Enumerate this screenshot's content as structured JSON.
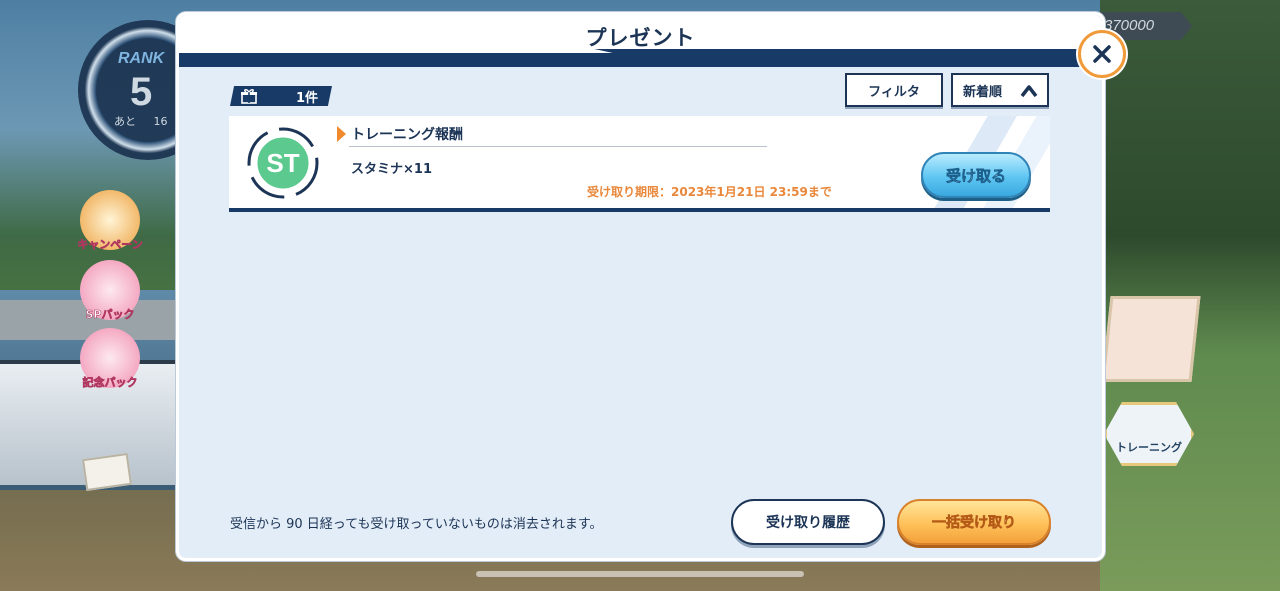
{
  "hud": {
    "rank_label": "RANK",
    "rank_value": "5",
    "rank_next_prefix": "あと",
    "rank_next_value": "16",
    "currency_partial": "370000",
    "side_buttons": [
      "キャンペーン",
      "SPパック",
      "記念パック"
    ],
    "training_label": "トレーニング"
  },
  "modal": {
    "title": "プレゼント",
    "count_label": "1件",
    "filter_label": "フィルタ",
    "sort_label": "新着順",
    "items": [
      {
        "icon_text": "ST",
        "name": "トレーニング報酬",
        "description": "スタミナ×11",
        "deadline": "受け取り期限：2023年1月21日 23:59まで",
        "receive_label": "受け取る"
      }
    ],
    "notice": "受信から 90 日経っても受け取っていないものは消去されます。",
    "history_label": "受け取り履歴",
    "bulk_label": "一括受け取り"
  },
  "colors": {
    "navy": "#173b66",
    "accent_orange": "#f09a3a",
    "receive_blue": "#5fc6f2",
    "bulk_gold": "#ffc15a",
    "st_green": "#5cc98f"
  },
  "icons": [
    "close-icon",
    "gift-icon",
    "chevron-up-icon",
    "stamina-st-icon"
  ]
}
